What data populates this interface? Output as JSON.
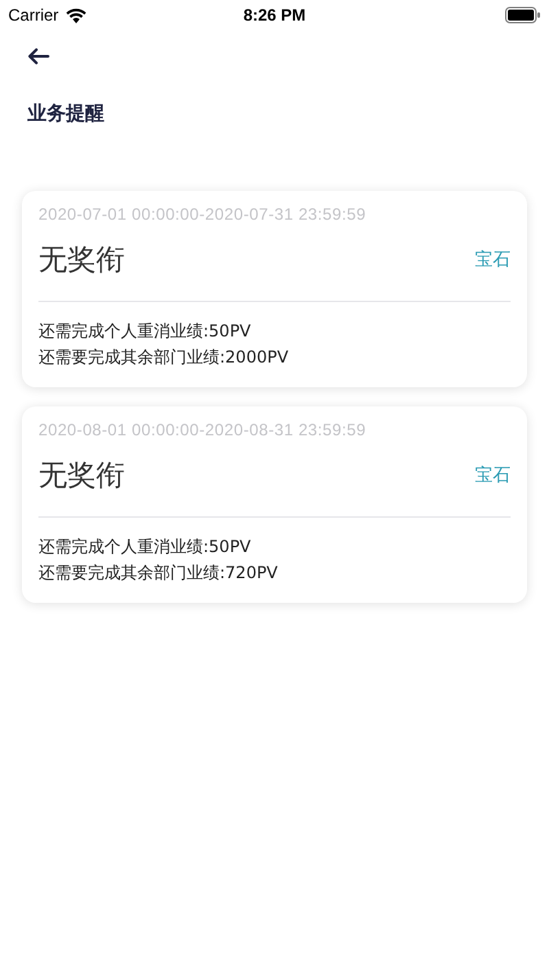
{
  "status_bar": {
    "carrier": "Carrier",
    "time": "8:26 PM"
  },
  "title": "业务提醒",
  "reminders": [
    {
      "period": "2020-07-01 00:00:00-2020-07-31 23:59:59",
      "name": "无奖衔",
      "tag": "宝石",
      "lines": [
        "还需完成个人重消业绩:50PV",
        "还需要完成其余部门业绩:2000PV"
      ]
    },
    {
      "period": "2020-08-01 00:00:00-2020-08-31 23:59:59",
      "name": "无奖衔",
      "tag": "宝石",
      "lines": [
        "还需完成个人重消业绩:50PV",
        "还需要完成其余部门业绩:720PV"
      ]
    }
  ]
}
